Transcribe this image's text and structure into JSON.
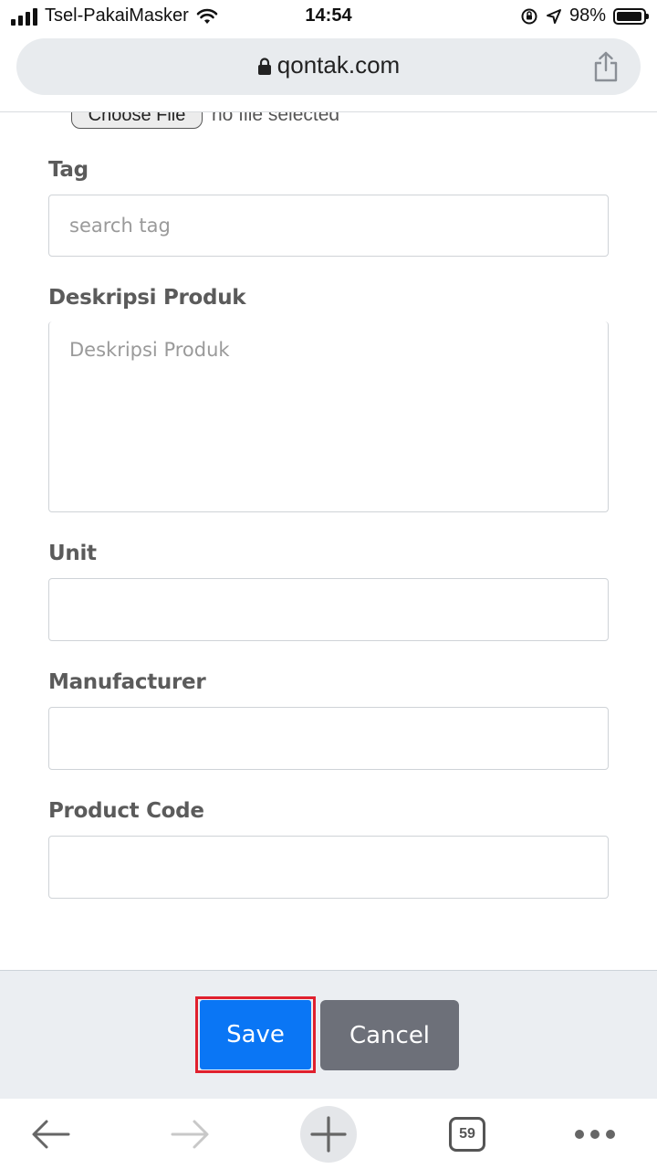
{
  "status_bar": {
    "carrier": "Tsel-PakaiMasker",
    "time": "14:54",
    "battery_percent": "98%",
    "battery_level": 0.98,
    "icons": [
      "signal-icon",
      "wifi-icon",
      "orientation-lock-icon",
      "location-icon",
      "battery-icon"
    ]
  },
  "browser": {
    "url": "qontak.com",
    "tab_count": "59"
  },
  "form": {
    "file_button_label": "Choose File",
    "file_status": "no file selected",
    "tag_label": "Tag",
    "tag_placeholder": "search tag",
    "description_label": "Deskripsi Produk",
    "description_placeholder": "Deskripsi Produk",
    "unit_label": "Unit",
    "unit_value": "",
    "manufacturer_label": "Manufacturer",
    "manufacturer_value": "",
    "product_code_label": "Product Code",
    "product_code_value": ""
  },
  "actions": {
    "save_label": "Save",
    "cancel_label": "Cancel"
  },
  "colors": {
    "save": "#0a76f5",
    "cancel": "#6d7079",
    "highlight": "#e0202e"
  }
}
